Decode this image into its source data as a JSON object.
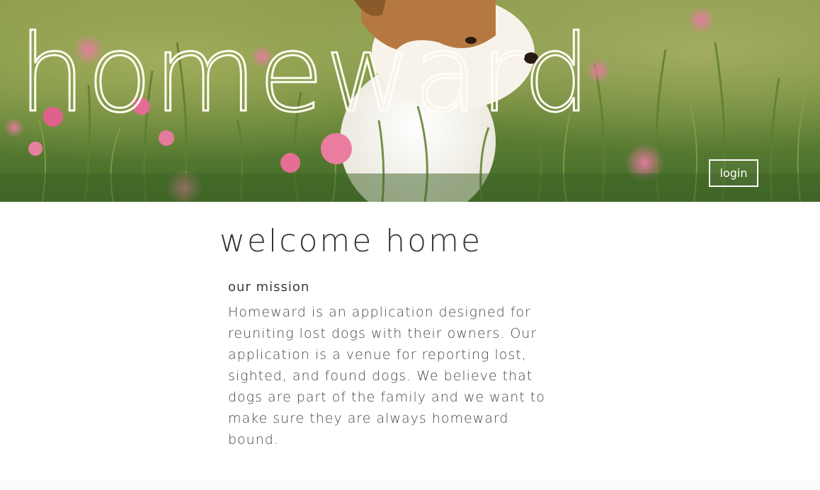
{
  "header": {
    "brand": "homeward",
    "login_label": "login",
    "image_icon": "puppy-in-flower-field-photo"
  },
  "main": {
    "title": "welcome home",
    "mission_heading": "our mission",
    "mission_text": "Homeward is an application designed for reuniting lost dogs with their owners. Our application is a venue for reporting lost, sighted, and found dogs. We believe that dogs are part of the family and we want to make sure they are always homeward bound."
  },
  "colors": {
    "brand_text": "#fffdf5",
    "body_text": "#333333",
    "background": "#ffffff"
  }
}
